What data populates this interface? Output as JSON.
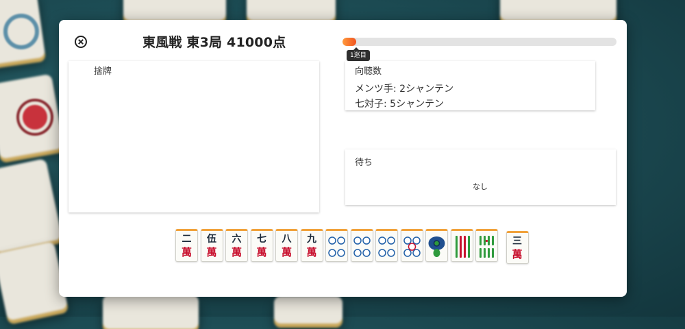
{
  "header": {
    "title": "東風戦 東3局 41000点",
    "progress_percent": 5,
    "turn_badge": "1巡目"
  },
  "discard": {
    "label": "捨牌"
  },
  "shanten": {
    "title": "向聴数",
    "lines": [
      "メンツ手: 2シャンテン",
      "七対子: 5シャンテン"
    ]
  },
  "wait": {
    "title": "待ち",
    "value": "なし"
  },
  "hand": {
    "tiles": [
      {
        "top": "二",
        "bottom": "萬",
        "kind": "man"
      },
      {
        "top": "伍",
        "bottom": "萬",
        "kind": "man"
      },
      {
        "top": "六",
        "bottom": "萬",
        "kind": "man"
      },
      {
        "top": "七",
        "bottom": "萬",
        "kind": "man"
      },
      {
        "top": "八",
        "bottom": "萬",
        "kind": "man"
      },
      {
        "top": "九",
        "bottom": "萬",
        "kind": "man"
      },
      {
        "top": "",
        "bottom": "",
        "kind": "pin4"
      },
      {
        "top": "",
        "bottom": "",
        "kind": "pin4"
      },
      {
        "top": "",
        "bottom": "",
        "kind": "pin4"
      },
      {
        "top": "",
        "bottom": "",
        "kind": "pin5"
      },
      {
        "top": "",
        "bottom": "",
        "kind": "sou1"
      },
      {
        "top": "",
        "bottom": "",
        "kind": "sou4"
      },
      {
        "top": "",
        "bottom": "",
        "kind": "sou6"
      }
    ],
    "drawn": {
      "top": "三",
      "bottom": "萬",
      "kind": "man"
    }
  },
  "colors": {
    "accent": "#f0531f",
    "tile_border": "#f1a23b",
    "man_red": "#c8102e",
    "pin_blue": "#1f5fa8",
    "sou_green": "#2e9a3c"
  }
}
